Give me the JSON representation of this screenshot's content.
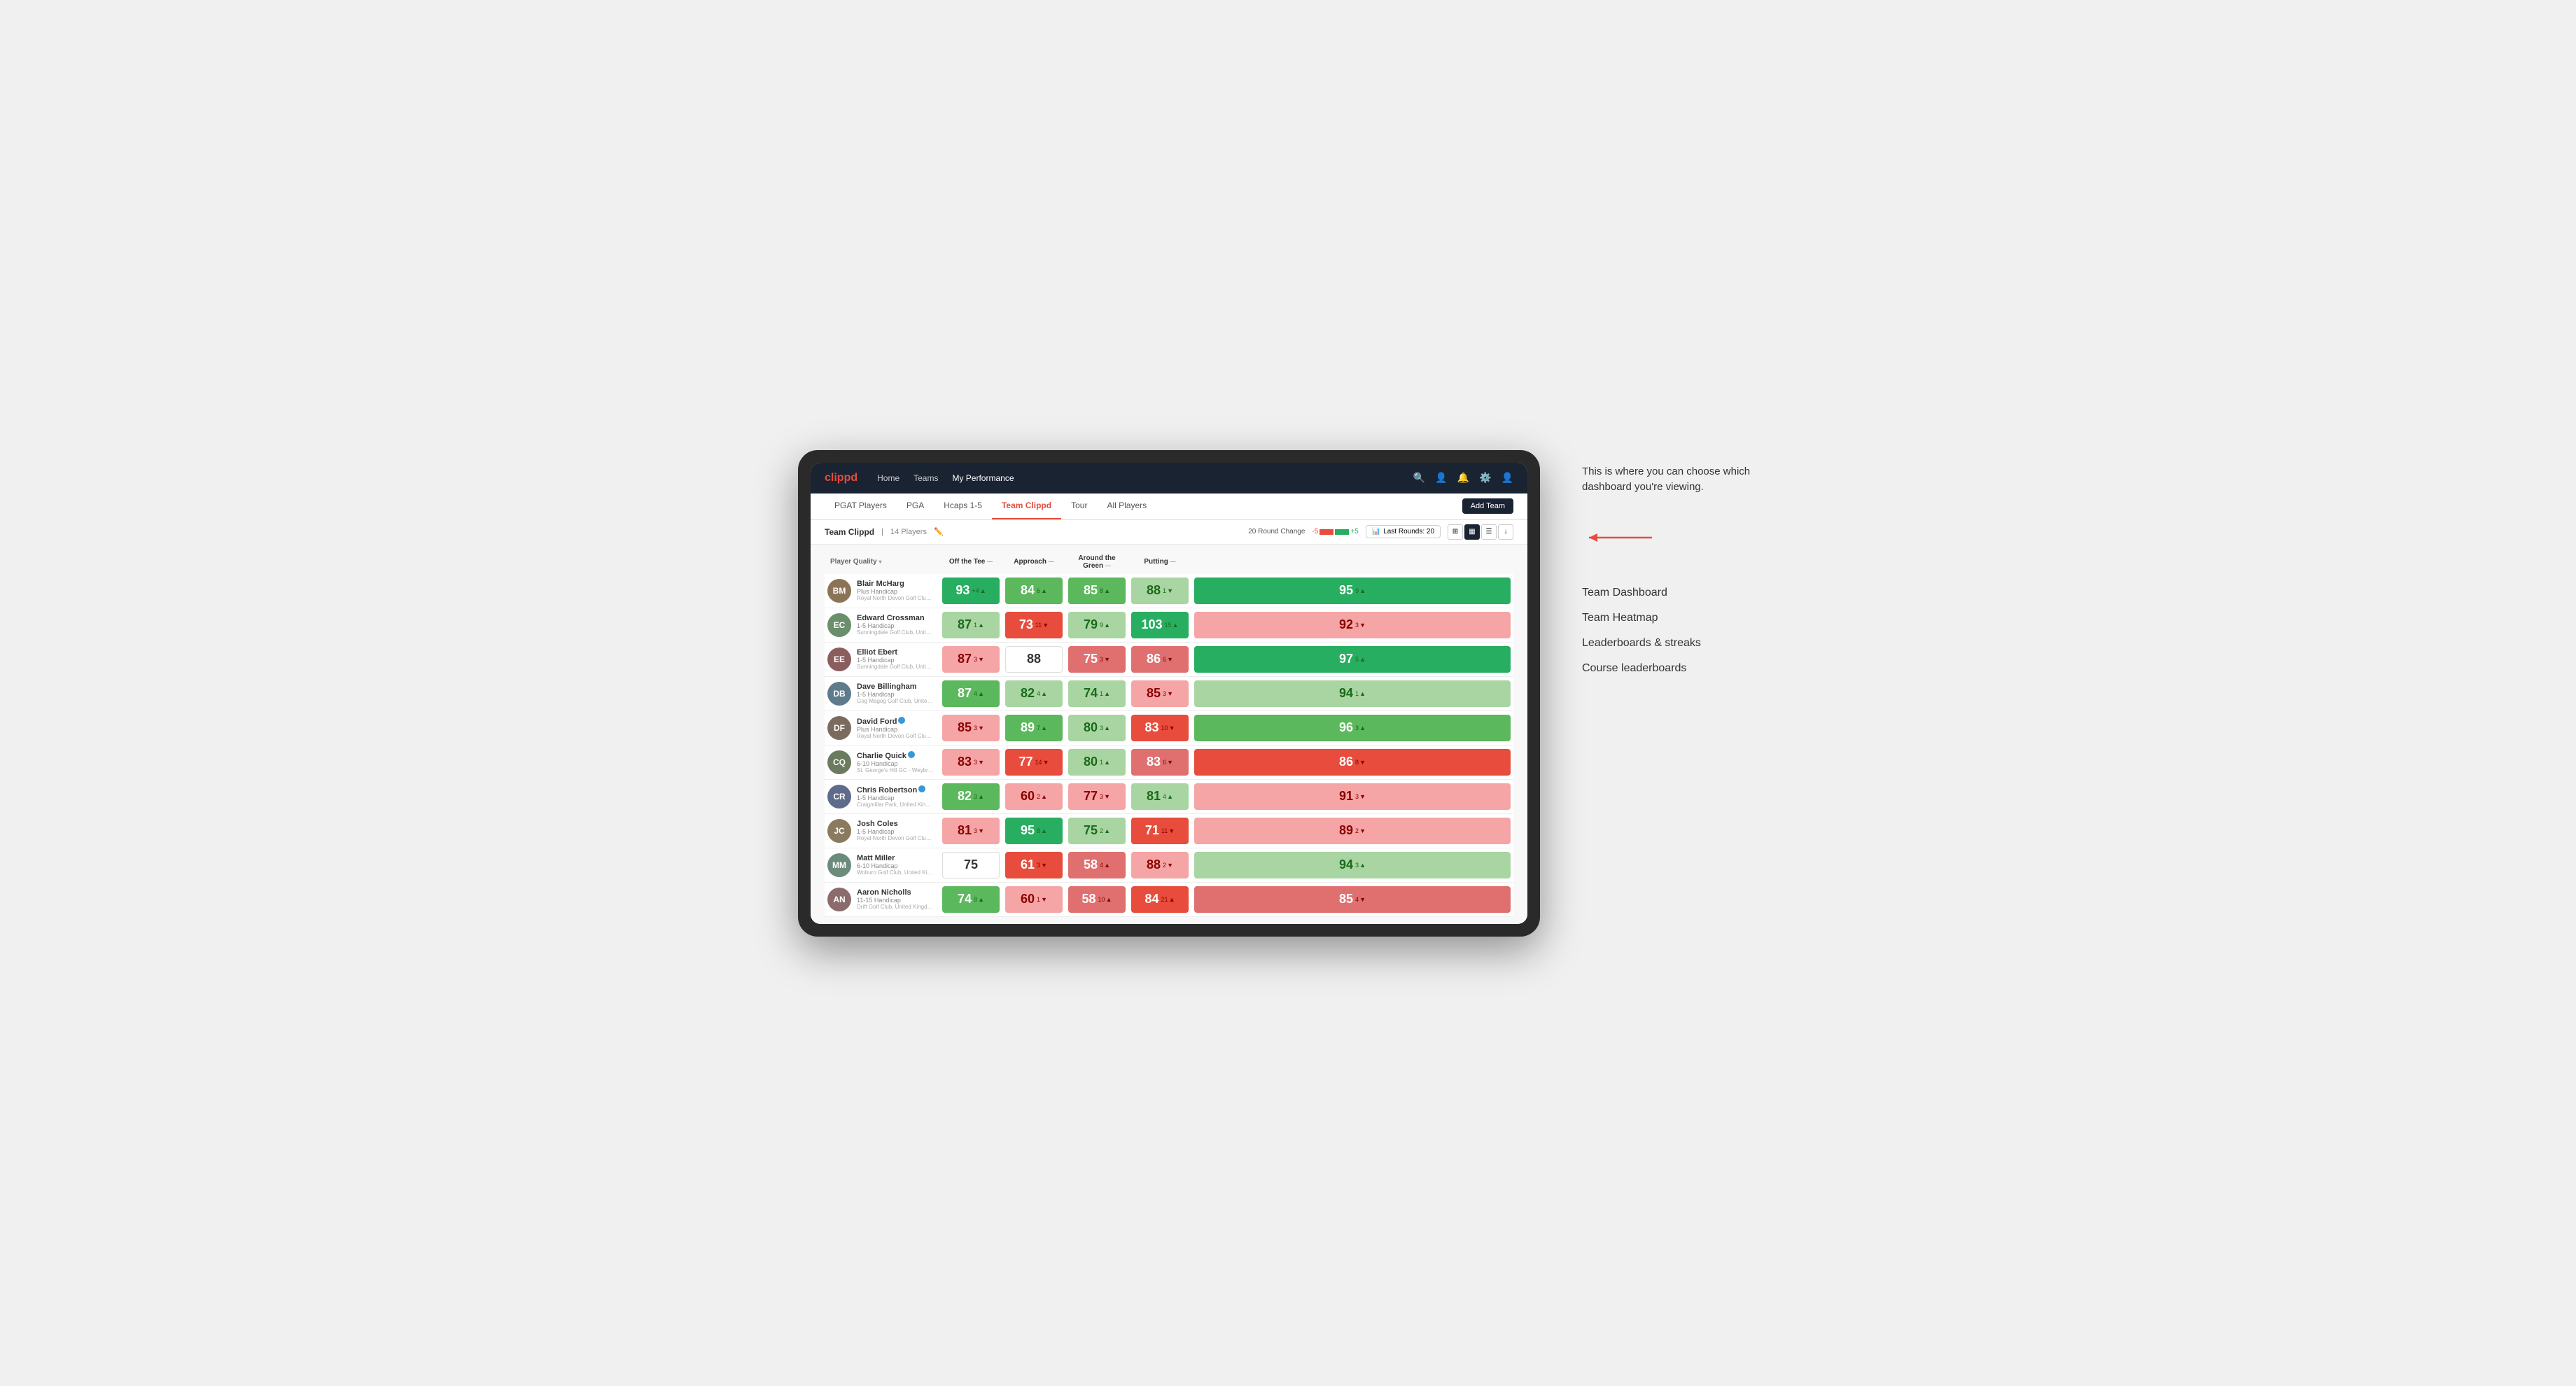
{
  "annotation": {
    "text": "This is where you can choose which dashboard you're viewing.",
    "arrow": "→",
    "options": [
      "Team Dashboard",
      "Team Heatmap",
      "Leaderboards & streaks",
      "Course leaderboards"
    ]
  },
  "nav": {
    "logo": "clippd",
    "links": [
      "Home",
      "Teams",
      "My Performance"
    ],
    "active_link": "My Performance"
  },
  "sub_nav": {
    "links": [
      "PGAT Players",
      "PGA",
      "Hcaps 1-5",
      "Team Clippd",
      "Tour",
      "All Players"
    ],
    "active": "Team Clippd",
    "add_team_label": "Add Team"
  },
  "team_header": {
    "name": "Team Clippd",
    "separator": "|",
    "count": "14 Players",
    "round_change_label": "20 Round Change",
    "change_neg": "-5",
    "change_pos": "+5",
    "last_rounds_label": "Last Rounds:",
    "last_rounds_value": "20"
  },
  "table": {
    "columns": {
      "player": "Player Quality",
      "off_tee": "Off the Tee",
      "approach": "Approach",
      "around_green": "Around the Green",
      "putting": "Putting"
    },
    "players": [
      {
        "name": "Blair McHarg",
        "handicap": "Plus Handicap",
        "club": "Royal North Devon Golf Club, United Kingdom",
        "avatar_color": "#8B7355",
        "initials": "BM",
        "scores": {
          "player_quality": {
            "value": "93",
            "change": "+4",
            "direction": "up",
            "color": "bg-green-dark"
          },
          "off_tee": {
            "value": "84",
            "change": "6",
            "direction": "up",
            "color": "bg-green-mid"
          },
          "approach": {
            "value": "85",
            "change": "8",
            "direction": "up",
            "color": "bg-green-mid"
          },
          "around_green": {
            "value": "88",
            "change": "1",
            "direction": "down",
            "color": "bg-green-light"
          },
          "putting": {
            "value": "95",
            "change": "9",
            "direction": "up",
            "color": "bg-green-dark"
          }
        }
      },
      {
        "name": "Edward Crossman",
        "handicap": "1-5 Handicap",
        "club": "Sunningdale Golf Club, United Kingdom",
        "avatar_color": "#6B8E6B",
        "initials": "EC",
        "scores": {
          "player_quality": {
            "value": "87",
            "change": "1",
            "direction": "up",
            "color": "bg-green-light"
          },
          "off_tee": {
            "value": "73",
            "change": "11",
            "direction": "down",
            "color": "bg-red-dark"
          },
          "approach": {
            "value": "79",
            "change": "9",
            "direction": "up",
            "color": "bg-green-light"
          },
          "around_green": {
            "value": "103",
            "change": "15",
            "direction": "up",
            "color": "bg-green-dark"
          },
          "putting": {
            "value": "92",
            "change": "3",
            "direction": "down",
            "color": "bg-red-light"
          }
        }
      },
      {
        "name": "Elliot Ebert",
        "handicap": "1-5 Handicap",
        "club": "Sunningdale Golf Club, United Kingdom",
        "avatar_color": "#8B5E5E",
        "initials": "EE",
        "scores": {
          "player_quality": {
            "value": "87",
            "change": "3",
            "direction": "down",
            "color": "bg-red-light"
          },
          "off_tee": {
            "value": "88",
            "change": "",
            "direction": "neutral",
            "color": "bg-white"
          },
          "approach": {
            "value": "75",
            "change": "3",
            "direction": "down",
            "color": "bg-red-mid"
          },
          "around_green": {
            "value": "86",
            "change": "6",
            "direction": "down",
            "color": "bg-red-mid"
          },
          "putting": {
            "value": "97",
            "change": "5",
            "direction": "up",
            "color": "bg-green-dark"
          }
        }
      },
      {
        "name": "Dave Billingham",
        "handicap": "1-5 Handicap",
        "club": "Gog Magog Golf Club, United Kingdom",
        "avatar_color": "#5E7B8B",
        "initials": "DB",
        "scores": {
          "player_quality": {
            "value": "87",
            "change": "4",
            "direction": "up",
            "color": "bg-green-mid"
          },
          "off_tee": {
            "value": "82",
            "change": "4",
            "direction": "up",
            "color": "bg-green-light"
          },
          "approach": {
            "value": "74",
            "change": "1",
            "direction": "up",
            "color": "bg-green-light"
          },
          "around_green": {
            "value": "85",
            "change": "3",
            "direction": "down",
            "color": "bg-red-light"
          },
          "putting": {
            "value": "94",
            "change": "1",
            "direction": "up",
            "color": "bg-green-light"
          }
        }
      },
      {
        "name": "David Ford",
        "handicap": "Plus Handicap",
        "club": "Royal North Devon Golf Club, United Kingdom",
        "avatar_color": "#7B6B5E",
        "initials": "DF",
        "verified": true,
        "scores": {
          "player_quality": {
            "value": "85",
            "change": "3",
            "direction": "down",
            "color": "bg-red-light"
          },
          "off_tee": {
            "value": "89",
            "change": "7",
            "direction": "up",
            "color": "bg-green-mid"
          },
          "approach": {
            "value": "80",
            "change": "3",
            "direction": "up",
            "color": "bg-green-light"
          },
          "around_green": {
            "value": "83",
            "change": "10",
            "direction": "down",
            "color": "bg-red-dark"
          },
          "putting": {
            "value": "96",
            "change": "3",
            "direction": "up",
            "color": "bg-green-mid"
          }
        }
      },
      {
        "name": "Charlie Quick",
        "handicap": "6-10 Handicap",
        "club": "St. George's Hill GC - Weybridge - Surrey, Uni...",
        "avatar_color": "#6B7B5E",
        "initials": "CQ",
        "verified": true,
        "scores": {
          "player_quality": {
            "value": "83",
            "change": "3",
            "direction": "down",
            "color": "bg-red-light"
          },
          "off_tee": {
            "value": "77",
            "change": "14",
            "direction": "down",
            "color": "bg-red-dark"
          },
          "approach": {
            "value": "80",
            "change": "1",
            "direction": "up",
            "color": "bg-green-light"
          },
          "around_green": {
            "value": "83",
            "change": "6",
            "direction": "down",
            "color": "bg-red-mid"
          },
          "putting": {
            "value": "86",
            "change": "8",
            "direction": "down",
            "color": "bg-red-dark"
          }
        }
      },
      {
        "name": "Chris Robertson",
        "handicap": "1-5 Handicap",
        "club": "Craigmillar Park, United Kingdom",
        "avatar_color": "#5E6B8B",
        "initials": "CR",
        "verified": true,
        "scores": {
          "player_quality": {
            "value": "82",
            "change": "3",
            "direction": "up",
            "color": "bg-green-mid"
          },
          "off_tee": {
            "value": "60",
            "change": "2",
            "direction": "up",
            "color": "bg-red-light"
          },
          "approach": {
            "value": "77",
            "change": "3",
            "direction": "down",
            "color": "bg-red-light"
          },
          "around_green": {
            "value": "81",
            "change": "4",
            "direction": "up",
            "color": "bg-green-light"
          },
          "putting": {
            "value": "91",
            "change": "3",
            "direction": "down",
            "color": "bg-red-light"
          }
        }
      },
      {
        "name": "Josh Coles",
        "handicap": "1-5 Handicap",
        "club": "Royal North Devon Golf Club, United Kingdom",
        "avatar_color": "#8B7B5E",
        "initials": "JC",
        "scores": {
          "player_quality": {
            "value": "81",
            "change": "3",
            "direction": "down",
            "color": "bg-red-light"
          },
          "off_tee": {
            "value": "95",
            "change": "8",
            "direction": "up",
            "color": "bg-green-dark"
          },
          "approach": {
            "value": "75",
            "change": "2",
            "direction": "up",
            "color": "bg-green-light"
          },
          "around_green": {
            "value": "71",
            "change": "11",
            "direction": "down",
            "color": "bg-red-dark"
          },
          "putting": {
            "value": "89",
            "change": "2",
            "direction": "down",
            "color": "bg-red-light"
          }
        }
      },
      {
        "name": "Matt Miller",
        "handicap": "6-10 Handicap",
        "club": "Woburn Golf Club, United Kingdom",
        "avatar_color": "#6B8B7B",
        "initials": "MM",
        "scores": {
          "player_quality": {
            "value": "75",
            "change": "",
            "direction": "neutral",
            "color": "bg-white"
          },
          "off_tee": {
            "value": "61",
            "change": "3",
            "direction": "down",
            "color": "bg-red-dark"
          },
          "approach": {
            "value": "58",
            "change": "4",
            "direction": "up",
            "color": "bg-red-mid"
          },
          "around_green": {
            "value": "88",
            "change": "2",
            "direction": "down",
            "color": "bg-red-light"
          },
          "putting": {
            "value": "94",
            "change": "3",
            "direction": "up",
            "color": "bg-green-light"
          }
        }
      },
      {
        "name": "Aaron Nicholls",
        "handicap": "11-15 Handicap",
        "club": "Drift Golf Club, United Kingdom",
        "avatar_color": "#8B6B6B",
        "initials": "AN",
        "scores": {
          "player_quality": {
            "value": "74",
            "change": "8",
            "direction": "up",
            "color": "bg-green-mid"
          },
          "off_tee": {
            "value": "60",
            "change": "1",
            "direction": "down",
            "color": "bg-red-light"
          },
          "approach": {
            "value": "58",
            "change": "10",
            "direction": "up",
            "color": "bg-red-mid"
          },
          "around_green": {
            "value": "84",
            "change": "21",
            "direction": "up",
            "color": "bg-red-dark"
          },
          "putting": {
            "value": "85",
            "change": "4",
            "direction": "down",
            "color": "bg-red-mid"
          }
        }
      }
    ]
  }
}
